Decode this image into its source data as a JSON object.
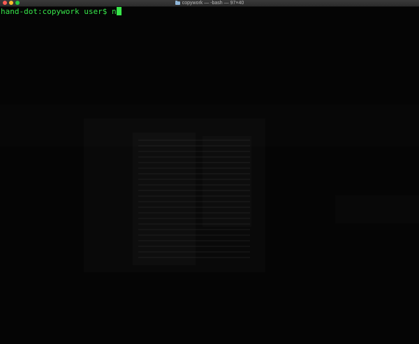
{
  "window": {
    "title": "copywork — -bash — 97×40",
    "title_icon": "folder-icon",
    "colors": {
      "close": "#fd5c55",
      "minimize": "#fdbc2e",
      "zoom": "#27c93f",
      "terminal_text": "#37e64a",
      "terminal_bg": "#050505"
    }
  },
  "terminal": {
    "prompt": "hand-dot:copywork user$ ",
    "input": "n"
  }
}
